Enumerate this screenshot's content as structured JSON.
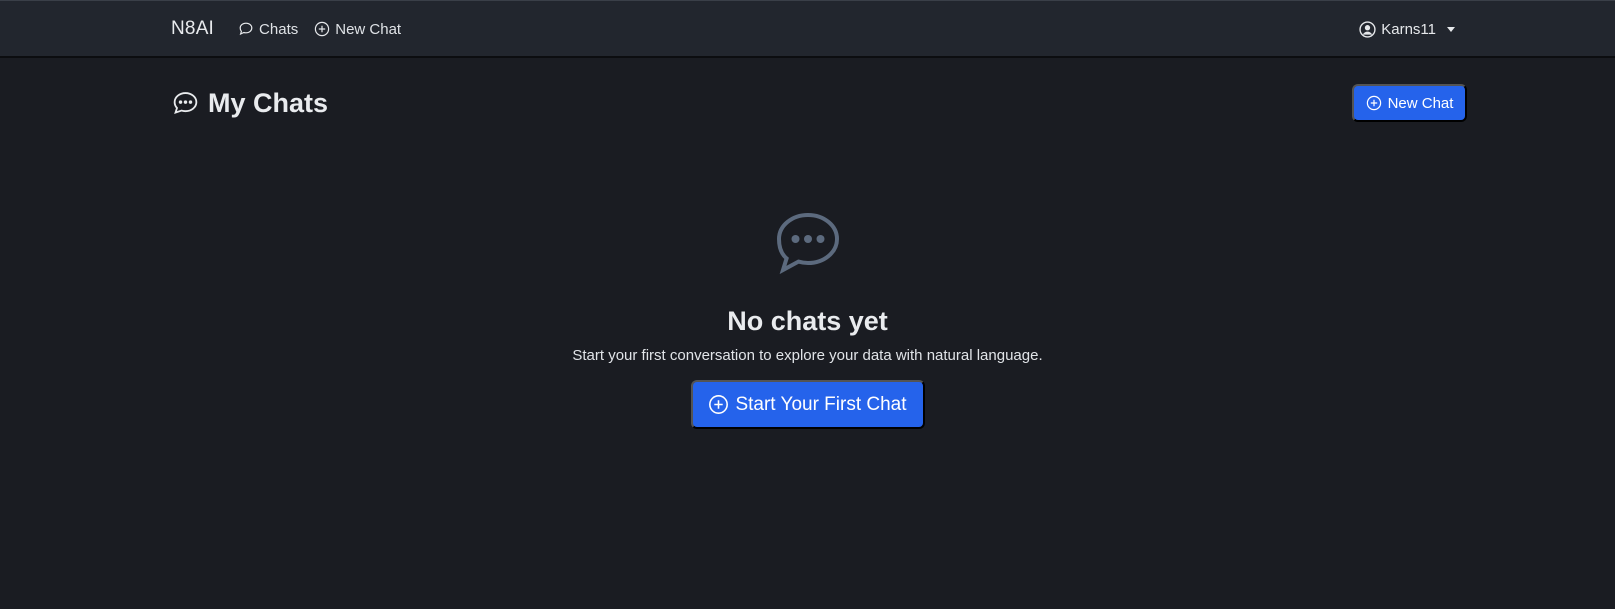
{
  "navbar": {
    "brand": "N8AI",
    "links": [
      {
        "label": "Chats",
        "icon": "chat-icon"
      },
      {
        "label": "New Chat",
        "icon": "plus-circle-icon"
      }
    ],
    "user": {
      "name": "Karns11",
      "icon": "user-circle-icon"
    }
  },
  "header": {
    "title": "My Chats",
    "title_icon": "chat-dots-icon",
    "new_chat_label": "New Chat"
  },
  "empty_state": {
    "icon": "chat-dots-icon",
    "title": "No chats yet",
    "description": "Start your first conversation to explore your data with natural language.",
    "button_label": "Start Your First Chat"
  },
  "colors": {
    "background": "#1a1c22",
    "navbar": "#22262e",
    "accent": "#2563eb",
    "empty_icon": "#5c6a7e"
  }
}
